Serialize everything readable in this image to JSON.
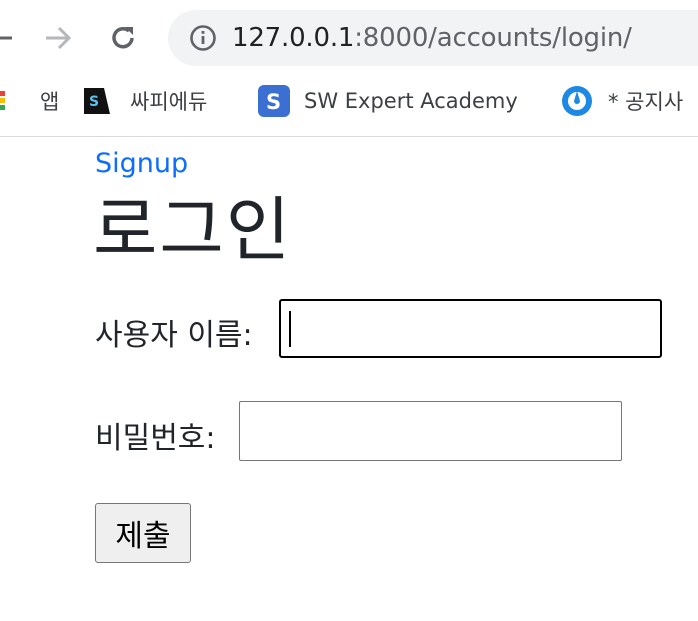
{
  "browser": {
    "url_host": "127.0.0.1",
    "url_rest": ":8000/accounts/login/",
    "bookmarks": [
      {
        "label": "앱",
        "icon": "apps-grid-icon"
      },
      {
        "label": "싸피에듀",
        "icon": "ssafy-icon"
      },
      {
        "label": "SW Expert Academy",
        "icon": "swea-icon"
      },
      {
        "label": "* 공지사",
        "icon": "mattermost-icon"
      }
    ]
  },
  "page": {
    "signup_link": "Signup",
    "title": "로그인",
    "username_label": "사용자 이름:",
    "username_value": "",
    "password_label": "비밀번호:",
    "password_value": "",
    "submit_label": "제출"
  },
  "colors": {
    "link": "#0d6efd",
    "omnibox_bg": "#f1f3f4",
    "swea_blue": "#3b6fd1",
    "mattermost_blue": "#1e88e5"
  }
}
